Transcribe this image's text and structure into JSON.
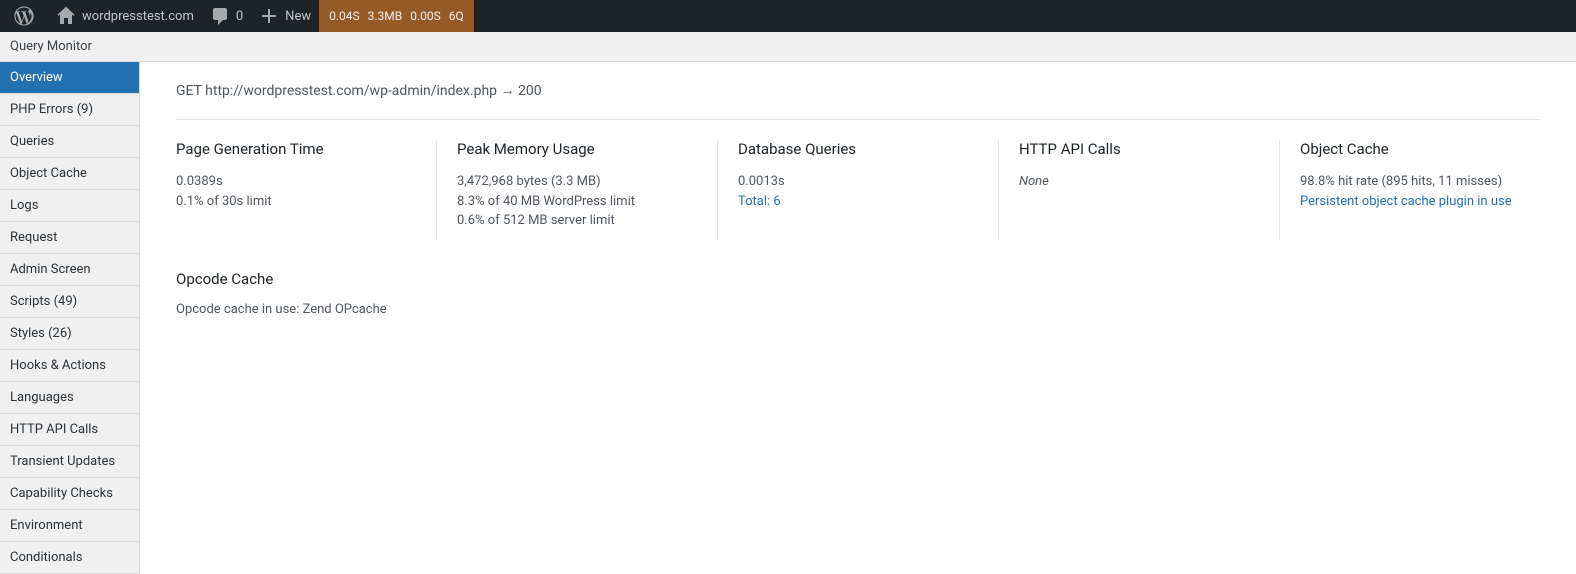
{
  "adminbar": {
    "site_name": "wordpresstest.com",
    "comments_count": "0",
    "new_label": "New",
    "qm": {
      "time": "0.04S",
      "memory": "3.3MB",
      "db_time": "0.00S",
      "queries": "6Q"
    }
  },
  "qm_title": "Query Monitor",
  "sidebar": {
    "items": [
      {
        "label": "Overview",
        "active": true
      },
      {
        "label": "PHP Errors (9)"
      },
      {
        "label": "Queries"
      },
      {
        "label": "Object Cache"
      },
      {
        "label": "Logs"
      },
      {
        "label": "Request"
      },
      {
        "label": "Admin Screen"
      },
      {
        "label": "Scripts (49)"
      },
      {
        "label": "Styles (26)"
      },
      {
        "label": "Hooks & Actions"
      },
      {
        "label": "Languages"
      },
      {
        "label": "HTTP API Calls"
      },
      {
        "label": "Transient Updates"
      },
      {
        "label": "Capability Checks"
      },
      {
        "label": "Environment"
      },
      {
        "label": "Conditionals"
      }
    ]
  },
  "request_line": "GET http://wordpresstest.com/wp-admin/index.php → 200",
  "panels": {
    "page_gen": {
      "title": "Page Generation Time",
      "value": "0.0389s",
      "note": "0.1% of 30s limit"
    },
    "memory": {
      "title": "Peak Memory Usage",
      "value": "3,472,968 bytes (3.3 MB)",
      "note1": "8.3% of 40 MB WordPress limit",
      "note2": "0.6% of 512 MB server limit"
    },
    "db": {
      "title": "Database Queries",
      "value": "0.0013s",
      "link": "Total: 6"
    },
    "http": {
      "title": "HTTP API Calls",
      "value": "None"
    },
    "object_cache": {
      "title": "Object Cache",
      "value": "98.8% hit rate (895 hits, 11 misses)",
      "link": "Persistent object cache plugin in use"
    }
  },
  "opcode": {
    "title": "Opcode Cache",
    "value": "Opcode cache in use: Zend OPcache"
  }
}
